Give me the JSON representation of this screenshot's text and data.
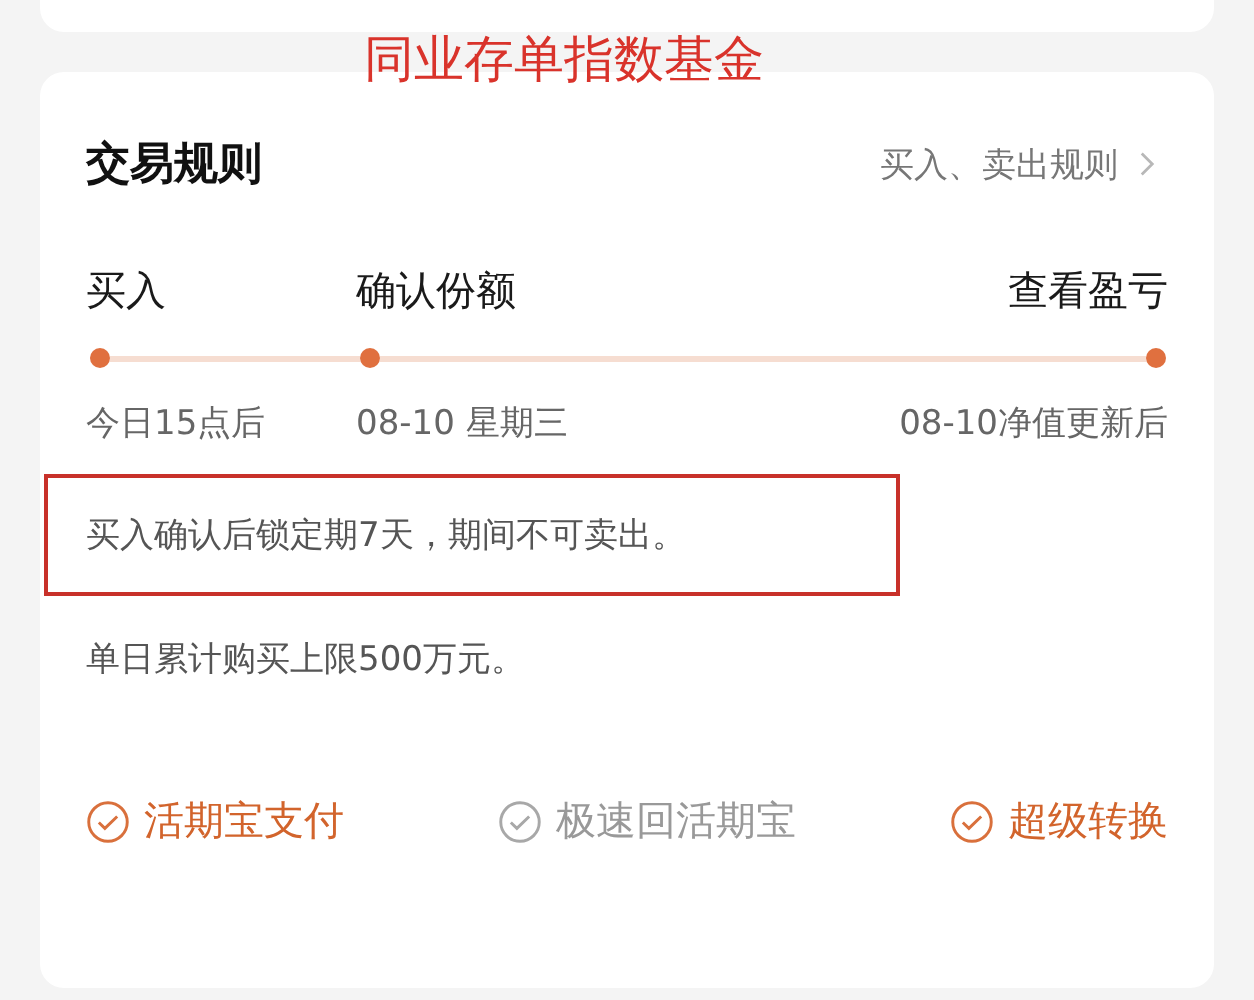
{
  "annotation_title": "同业存单指数基金",
  "card": {
    "title": "交易规则",
    "link": "买入、卖出规则"
  },
  "steps": [
    {
      "label": "买入",
      "date": "今日15点后"
    },
    {
      "label": "确认份额",
      "date": "08-10 星期三"
    },
    {
      "label": "查看盈亏",
      "date": "08-10净值更新后"
    }
  ],
  "notes": [
    {
      "text": "买入确认后锁定期7天，期间不可卖出。",
      "highlighted": true
    },
    {
      "text": "单日累计购买上限500万元。",
      "highlighted": false
    }
  ],
  "features": [
    {
      "label": "活期宝支付",
      "enabled": true
    },
    {
      "label": "极速回活期宝",
      "enabled": false
    },
    {
      "label": "超级转换",
      "enabled": true
    }
  ]
}
